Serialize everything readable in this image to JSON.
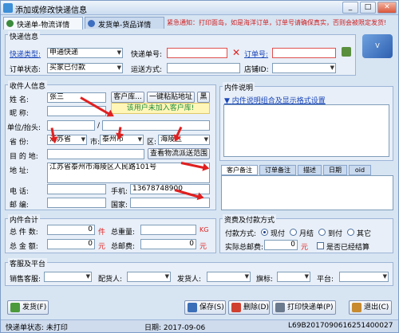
{
  "title": "添加或修改快递信息",
  "tabs": [
    "快递单-物流详情",
    "发货单-货品详情"
  ],
  "notice": "紧急通知：打印面岛，如是海洋订单，订单号请确保真实，否则会被限定发货!",
  "express": {
    "section": "快递信息",
    "type_label": "快递类型:",
    "type_value": "申通快递",
    "number_label": "快递单号:",
    "number_value": "",
    "order_no_label": "订单号:",
    "order_no_value": "",
    "status_label": "订单状态:",
    "status_value": "买家已付款",
    "ship_label": "运送方式:",
    "ship_value": "",
    "shop_label": "店铺ID:",
    "shop_value": ""
  },
  "receiver": {
    "section": "收件人信息",
    "name_label": "姓    名:",
    "name_value": "张三",
    "customer_btn": "客户库...",
    "paste_btn": "一键粘贴地址",
    "black_btn": "黑",
    "nick_label": "昵    称:",
    "nick_value": "",
    "hint": "该用户未加入客户库!",
    "unit_label": "单位/抬头:",
    "slash": "/",
    "province_label": "省    份:",
    "province_value": "江苏省",
    "city_label": "市:",
    "city_value": "泰州市",
    "district_label": "区:",
    "district_value": "海陵区",
    "dest_label": "目 的 地:",
    "dest_value": "",
    "check_btn": "查看物流派送范围",
    "address_label": "地    址:",
    "address_value": "江苏省泰州市海陵区人民路101号",
    "phone_label": "电    话:",
    "phone_value": "",
    "mobile_label": "手机:",
    "mobile_value": "13678748900",
    "zip_label": "邮    编:",
    "zip_value": "",
    "country_label": "国家:",
    "country_value": ""
  },
  "content": {
    "section": "内件说明",
    "combo": "内件说明组合及显示格式设置"
  },
  "subtabs": [
    "客户备注",
    "订单备注",
    "描述",
    "日期",
    "oid"
  ],
  "totals": {
    "section": "内件合计",
    "count_label": "总 件 数:",
    "count_value": "0",
    "count_unit": "件",
    "weight_label": "总重量:",
    "weight_value": "",
    "weight_unit": "KG",
    "amount_label": "总 金 额:",
    "amount_value": "0",
    "amount_unit": "元",
    "postage_label": "总邮费:",
    "postage_value": "0",
    "postage_unit": "元"
  },
  "payment": {
    "section": "资费及付款方式",
    "method_label": "付款方式:",
    "options": [
      "现付",
      "月结",
      "到付",
      "其它"
    ],
    "postage_label": "实际总邮费:",
    "postage_value": "0",
    "postage_unit": "元",
    "settled_label": "是否已经结算"
  },
  "service": {
    "section": "客服及平台",
    "sales_label": "销售客服:",
    "packer_label": "配货人:",
    "shipper_label": "发货人:",
    "flag_label": "旗标:",
    "platform_label": "平台:"
  },
  "footer": {
    "ship_btn": "发货(F)",
    "save_btn": "保存(S)",
    "delete_btn": "删除(D)",
    "print_btn": "打印快递单(P)",
    "exit_btn": "退出(C)"
  },
  "status_bar": {
    "state": "快递单状态: 未打印",
    "date": "日期: 2017-09-06",
    "id": "L69B2017090616251400027"
  },
  "logo_text": "V"
}
